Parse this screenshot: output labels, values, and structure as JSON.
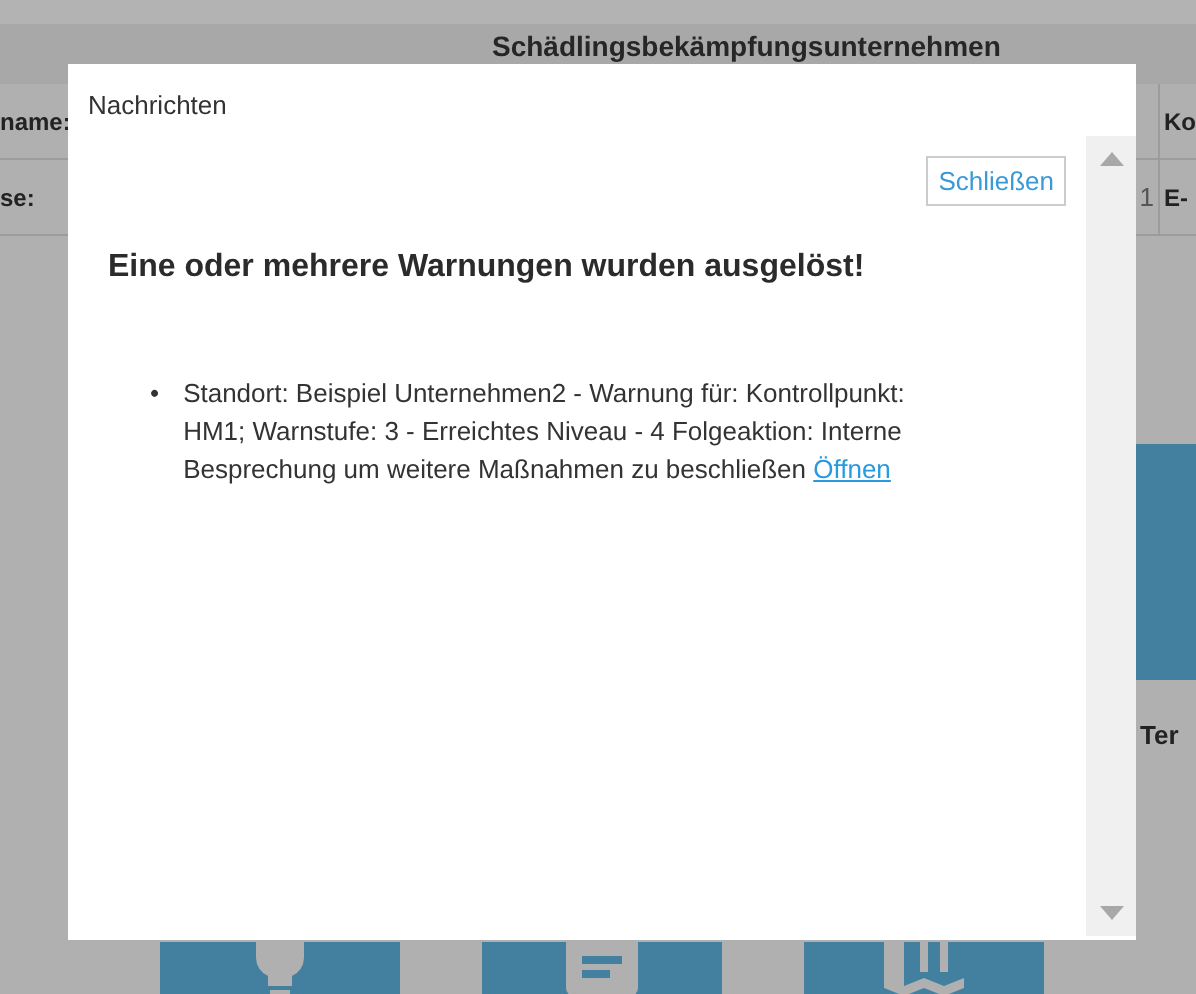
{
  "background": {
    "title": "Schädlingsbekämpfungsunternehmen",
    "rows": [
      {
        "label": "name:",
        "column_3": "Ko"
      },
      {
        "label": "se:",
        "value": "1",
        "column_3": "E-"
      }
    ],
    "tile_label": "Ter",
    "tiles": [
      {
        "kind": "bulb"
      },
      {
        "kind": "document"
      },
      {
        "kind": "map"
      }
    ]
  },
  "dialog": {
    "title": "Nachrichten",
    "close_button": "Schließen",
    "heading": "Eine oder mehrere Warnungen wurden ausgelöst!",
    "messages": [
      {
        "marker": "•",
        "text": "Standort: Beispiel Unternehmen2 - Warnung für: Kontrollpunkt: HM1; Warnstufe: 3 - Erreichtes Niveau - 4 Folgeaktion: Interne Besprechung um weitere Maßnahmen zu beschließen",
        "link": "Öffnen"
      }
    ]
  }
}
